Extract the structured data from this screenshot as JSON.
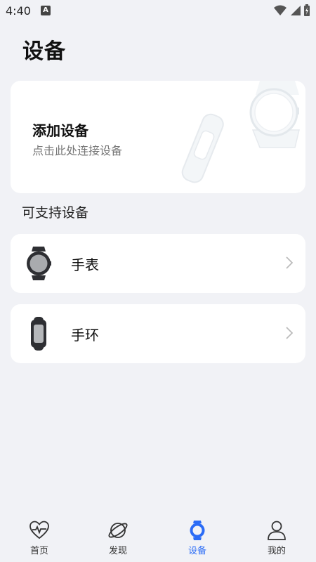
{
  "status_bar": {
    "time": "4:40",
    "notification": "A"
  },
  "header": {
    "title": "设备"
  },
  "add_device": {
    "title": "添加设备",
    "subtitle": "点击此处连接设备"
  },
  "supported": {
    "label": "可支持设备",
    "items": [
      {
        "label": "手表",
        "icon": "watch-icon"
      },
      {
        "label": "手环",
        "icon": "band-icon"
      }
    ]
  },
  "bottom_nav": {
    "items": [
      {
        "label": "首页",
        "icon": "heart-pulse-icon"
      },
      {
        "label": "发现",
        "icon": "planet-icon"
      },
      {
        "label": "设备",
        "icon": "device-icon",
        "active": true
      },
      {
        "label": "我的",
        "icon": "profile-icon"
      }
    ]
  },
  "colors": {
    "accent": "#2b6cf6",
    "background": "#f1f2f6",
    "card": "#ffffff"
  }
}
